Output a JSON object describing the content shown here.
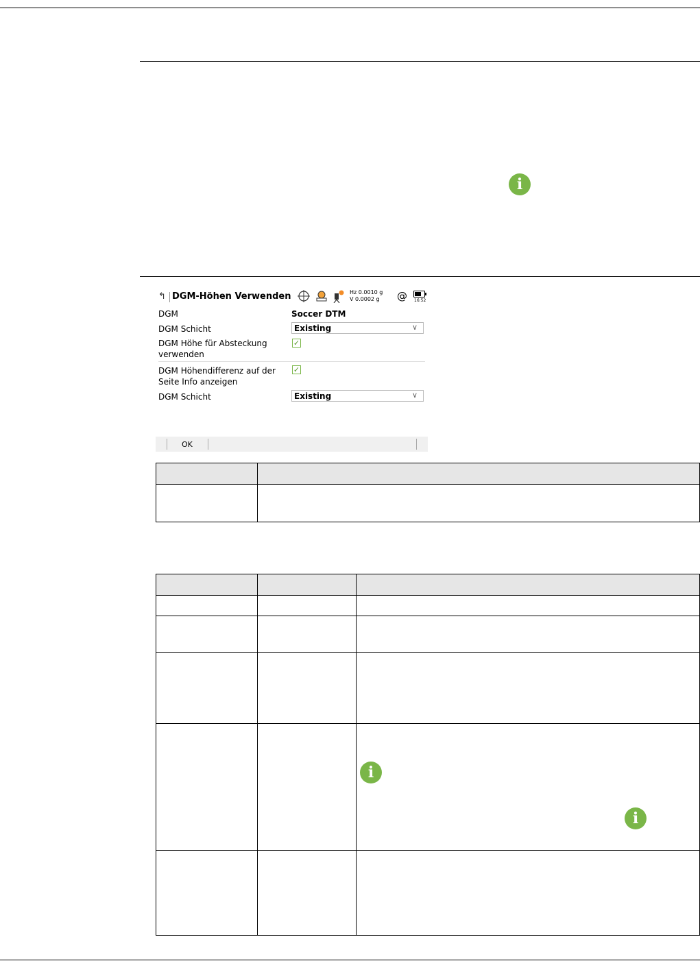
{
  "screen": {
    "title": "DGM-Höhen Verwenden",
    "hz_readout": "Hz 0.0010 g",
    "v_readout": "V   0.0002 g",
    "at_symbol": "@",
    "clock": "16:52",
    "rows": [
      {
        "label": "DGM",
        "value": "Soccer DTM"
      },
      {
        "label": "DGM Schicht",
        "value": "Existing"
      },
      {
        "label": "DGM Höhe für Absteckung verwenden",
        "checked": "✓"
      },
      {
        "label": "DGM Höhendifferenz auf der Seite Info anzeigen",
        "checked": "✓"
      },
      {
        "label": "DGM Schicht",
        "value": "Existing"
      }
    ],
    "softkey_ok": "OK"
  },
  "icons": [
    "info-icon",
    "back-arrow-icon",
    "crosshair-icon",
    "target-icon",
    "instrument-icon",
    "at-icon",
    "battery-icon",
    "checkbox-checked-icon",
    "chevron-down-icon"
  ],
  "colors": {
    "info_green": "#7ab648",
    "table_header": "#e6e6e6"
  }
}
